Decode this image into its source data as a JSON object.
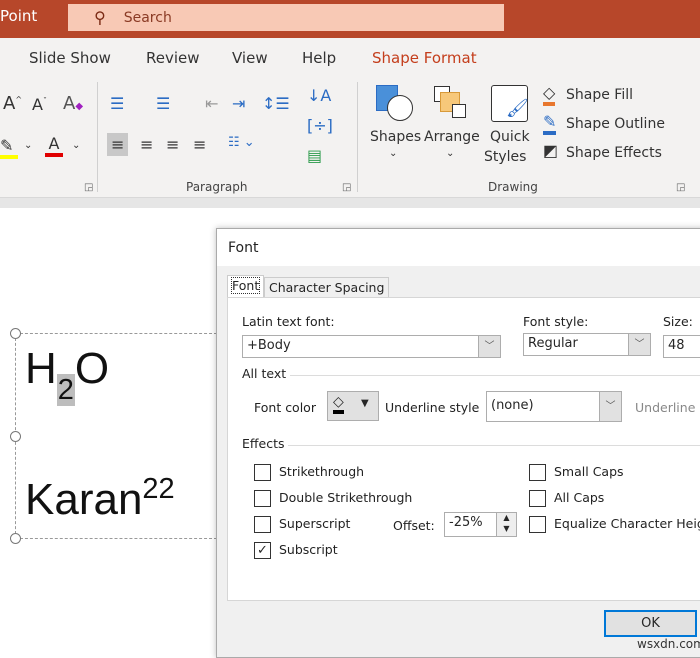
{
  "app": {
    "title_fragment": "Point",
    "search_placeholder": "Search",
    "search_icon": "search-icon",
    "accent": "#b7472a"
  },
  "menu_tabs": [
    {
      "label": "Slide Show"
    },
    {
      "label": "Review"
    },
    {
      "label": "View"
    },
    {
      "label": "Help"
    },
    {
      "label": "Shape Format",
      "active": true,
      "color": "#c43e1c"
    }
  ],
  "ribbon": {
    "paragraph_label": "Paragraph",
    "drawing_label": "Drawing",
    "shapes_label": "Shapes",
    "arrange_label": "Arrange",
    "quick_label": "Quick",
    "styles_label": "Styles",
    "shape_fill": "Shape Fill",
    "shape_outline": "Shape Outline",
    "shape_effects": "Shape Effects",
    "highlight_color": "#ffff00",
    "font_color": "#e00000"
  },
  "slide": {
    "line1_a": "H",
    "line1_sub": "2",
    "line1_b": "O",
    "line2": "Karan",
    "line2_sup": "22"
  },
  "dialog": {
    "title": "Font",
    "tabs": [
      "Font",
      "Character Spacing"
    ],
    "latin_font_label": "Latin text font:",
    "latin_font_value": "+Body",
    "font_style_label": "Font style:",
    "font_style_value": "Regular",
    "size_label": "Size:",
    "size_value": "48",
    "all_text_label": "All text",
    "font_color_label": "Font color",
    "underline_style_label": "Underline style",
    "underline_style_value": "(none)",
    "underline_color_label": "Underline c",
    "effects_label": "Effects",
    "effects": [
      {
        "label": "Strikethrough",
        "checked": false
      },
      {
        "label": "Double Strikethrough",
        "checked": false
      },
      {
        "label": "Superscript",
        "checked": false
      },
      {
        "label": "Subscript",
        "checked": true
      },
      {
        "label": "Small Caps",
        "checked": false
      },
      {
        "label": "All Caps",
        "checked": false
      },
      {
        "label": "Equalize Character Height",
        "checked": false
      }
    ],
    "offset_label": "Offset:",
    "offset_value": "-25%",
    "ok_label": "OK"
  },
  "watermark": "wsxdn.com"
}
